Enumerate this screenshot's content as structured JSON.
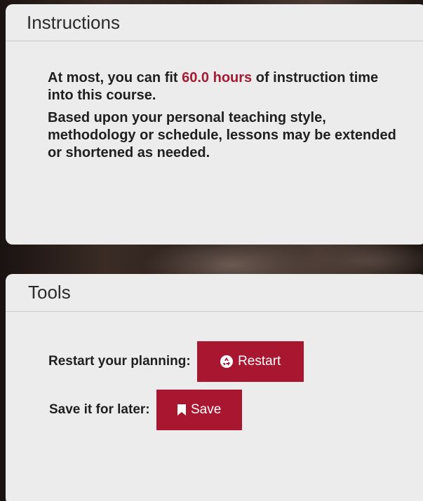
{
  "instructions": {
    "title": "Instructions",
    "line1_prefix": "At most, you can fit ",
    "line1_highlight": "60.0 hours",
    "line1_suffix": " of instruction time into this course.",
    "line2": "Based upon your personal teaching style, methodology or schedule, lessons may be extended or shortened as needed.",
    "highlight_color": "#a31b35"
  },
  "tools": {
    "title": "Tools",
    "restart_label": "Restart your planning:",
    "restart_button": "Restart",
    "restart_icon": "recycle-icon",
    "save_label": "Save it for later:",
    "save_button": "Save",
    "save_icon": "bookmark-icon",
    "button_color": "#a8162f"
  }
}
